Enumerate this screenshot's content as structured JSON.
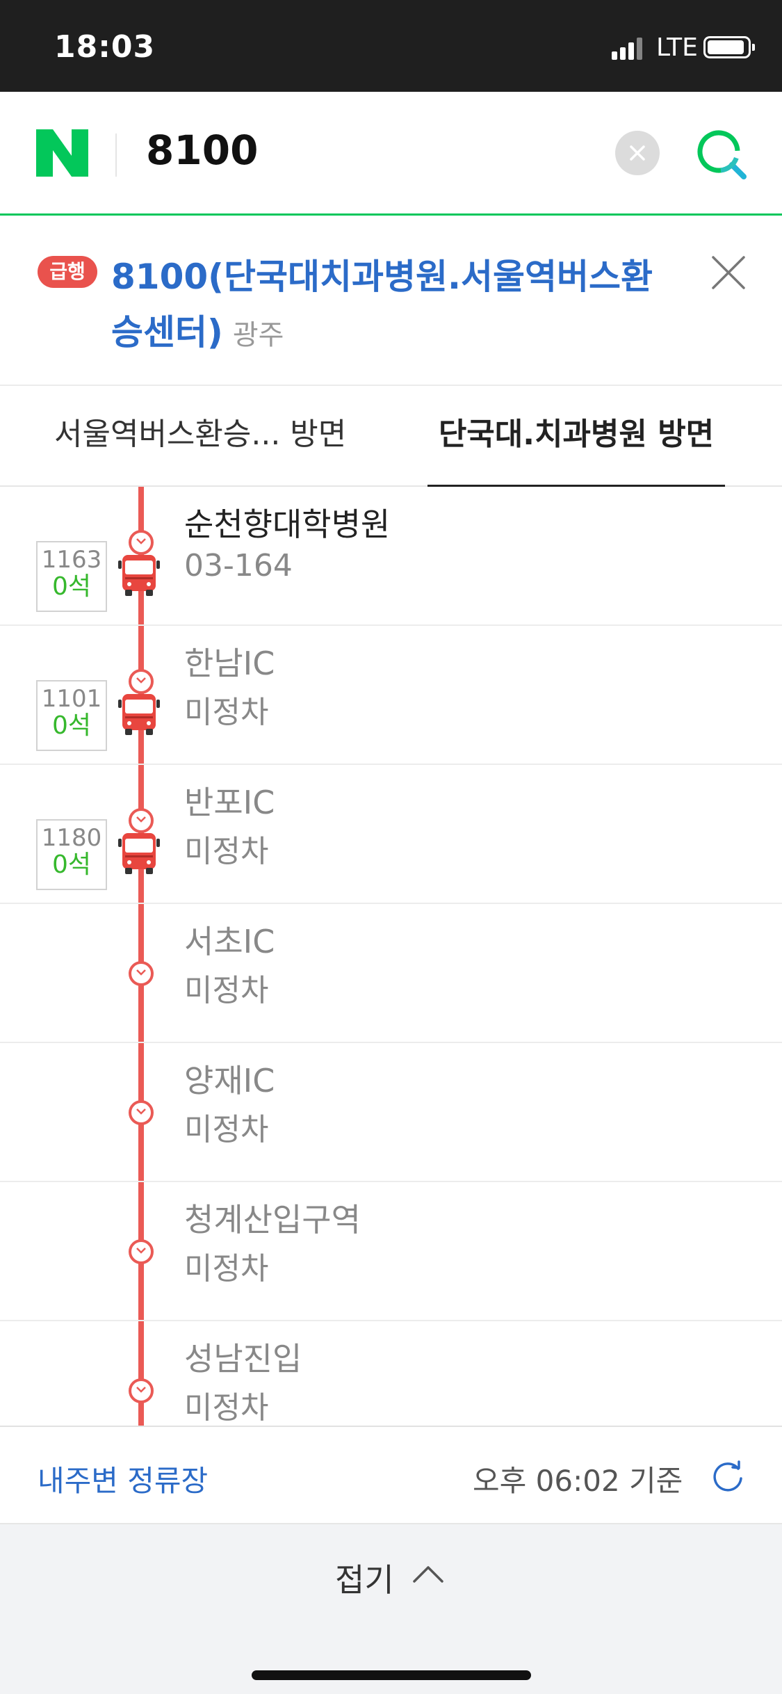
{
  "status_bar": {
    "time": "18:03",
    "network": "LTE"
  },
  "search": {
    "query": "8100"
  },
  "route": {
    "badge": "급행",
    "title": "8100(단국대치과병원.서울역버스환승센터)",
    "region": "광주",
    "accent_color": "#2b6bc8",
    "line_color": "#ea5a55"
  },
  "tabs": [
    {
      "label": "서울역버스환승... 방면",
      "active": false
    },
    {
      "label": "단국대.치과병원 방면",
      "active": true
    }
  ],
  "stops": [
    {
      "name": "순천향대학병원",
      "status": "03-164",
      "bus": {
        "number": "1163",
        "seats": "0석"
      }
    },
    {
      "name": "한남IC",
      "status": "미정차",
      "bus": {
        "number": "1101",
        "seats": "0석"
      }
    },
    {
      "name": "반포IC",
      "status": "미정차",
      "bus": {
        "number": "1180",
        "seats": "0석"
      }
    },
    {
      "name": "서초IC",
      "status": "미정차"
    },
    {
      "name": "양재IC",
      "status": "미정차"
    },
    {
      "name": "청계산입구역",
      "status": "미정차"
    },
    {
      "name": "성남진입",
      "status": "미정차"
    }
  ],
  "footer": {
    "nearby_label": "내주변 정류장",
    "timestamp": "오후 06:02 기준"
  },
  "collapse_label": "접기"
}
